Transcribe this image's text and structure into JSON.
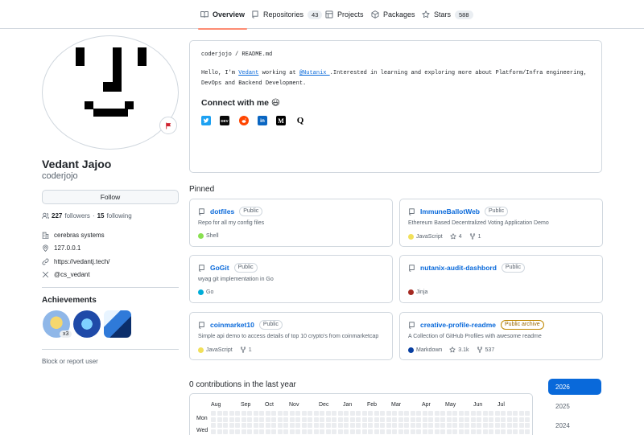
{
  "nav": {
    "tabs": [
      {
        "label": "Overview",
        "icon": "book-icon",
        "active": true
      },
      {
        "label": "Repositories",
        "icon": "repo-icon",
        "count": "43"
      },
      {
        "label": "Projects",
        "icon": "table-icon"
      },
      {
        "label": "Packages",
        "icon": "package-icon"
      },
      {
        "label": "Stars",
        "icon": "star-icon",
        "count": "588"
      }
    ]
  },
  "profile": {
    "name": "Vedant Jajoo",
    "login": "coderjojo",
    "follow_label": "Follow",
    "followers_count": "227",
    "followers_label": "followers",
    "dot": "·",
    "following_count": "15",
    "following_label": "following",
    "company": "cerebras systems",
    "location": "127.0.0.1",
    "website": "https://vedantj.tech/",
    "twitter": "@cs_vedant",
    "flag_icon": "flag-icon"
  },
  "achievements": {
    "title": "Achievements",
    "badge_count": "x3",
    "badges": [
      "pull-shark-badge",
      "yolo-badge",
      "starstruck-badge"
    ]
  },
  "block_label": "Block or report user",
  "readme": {
    "path_user": "coderjojo",
    "path_sep": "/",
    "path_file": "README.md",
    "intro_a": "Hello, I'm ",
    "intro_link1": "Vedant",
    "intro_b": " working at ",
    "intro_link2": "@Nutanix ",
    "intro_c": ".Interested in learning and exploring more about Platform/Infra engineering,",
    "intro_d": "DevOps and Backend Development.",
    "connect": "Connect with me 😃",
    "socials": [
      "twitter-icon",
      "dev-icon",
      "reddit-icon",
      "linkedin-icon",
      "medium-icon",
      "quora-icon"
    ]
  },
  "pinned": {
    "title": "Pinned",
    "cards": [
      {
        "name": "dotfiles",
        "visibility": "Public",
        "desc": "Repo for all my config files",
        "lang": "Shell",
        "color": "#89e051",
        "stars": "",
        "forks": ""
      },
      {
        "name": "ImmuneBallotWeb",
        "visibility": "Public",
        "desc": "Ethereum Based Decentralized Voting Application Demo",
        "lang": "JavaScript",
        "color": "#f1e05a",
        "stars": "4",
        "forks": "1"
      },
      {
        "name": "GoGit",
        "visibility": "Public",
        "desc": "wyag git implementation in Go",
        "lang": "Go",
        "color": "#00add8",
        "stars": "",
        "forks": ""
      },
      {
        "name": "nutanix-audit-dashbord",
        "visibility": "Public",
        "desc": "",
        "lang": "Jinja",
        "color": "#a52a22",
        "stars": "",
        "forks": ""
      },
      {
        "name": "coinmarket10",
        "visibility": "Public",
        "desc": "Simple api demo to access details of top 10 crypto's from coinmarketcap",
        "lang": "JavaScript",
        "color": "#f1e05a",
        "stars": "",
        "forks": "1"
      },
      {
        "name": "creative-profile-readme",
        "visibility": "Public archive",
        "desc": "A Collection of GitHub Profiles with awesome readme",
        "lang": "Markdown",
        "color": "#083fa1",
        "stars": "3.1k",
        "forks": "537"
      }
    ]
  },
  "contributions": {
    "title": "0 contributions in the last year",
    "months": [
      "Aug",
      "Sep",
      "Oct",
      "Nov",
      "Dec",
      "Jan",
      "Feb",
      "Mar",
      "Apr",
      "May",
      "Jun",
      "Jul"
    ],
    "days": [
      "Mon",
      "Wed"
    ],
    "years": [
      "2026",
      "2025",
      "2024"
    ],
    "active_year": "2026"
  }
}
